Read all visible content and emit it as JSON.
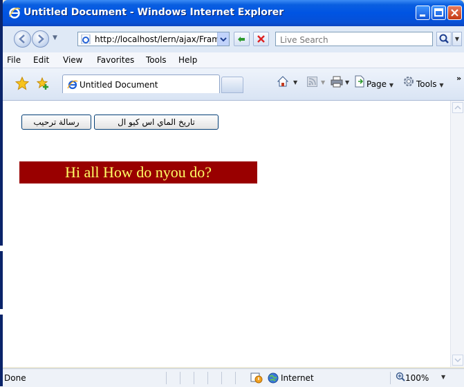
{
  "window": {
    "title": "Untitled Document - Windows Internet Explorer"
  },
  "address_bar": {
    "url": "http://localhost/lern/ajax/Fram"
  },
  "search": {
    "placeholder": "Live Search"
  },
  "menu": {
    "items": [
      "File",
      "Edit",
      "View",
      "Favorites",
      "Tools",
      "Help"
    ]
  },
  "tab": {
    "title": "Untitled Document"
  },
  "commands": {
    "page_label": "Page",
    "tools_label": "Tools"
  },
  "page": {
    "welcome_button": "رسالة ترحيب",
    "date_button": "تاريخ الماي اس كيو ال",
    "banner_text": "Hi all How do nyou do?",
    "banner_bg": "#990000",
    "banner_fg": "#ffff66"
  },
  "status": {
    "text": "Done",
    "zone": "Internet",
    "zoom": "100%"
  },
  "colors": {
    "titlebar": "#0054e3",
    "window_frame": "#0a246a"
  }
}
